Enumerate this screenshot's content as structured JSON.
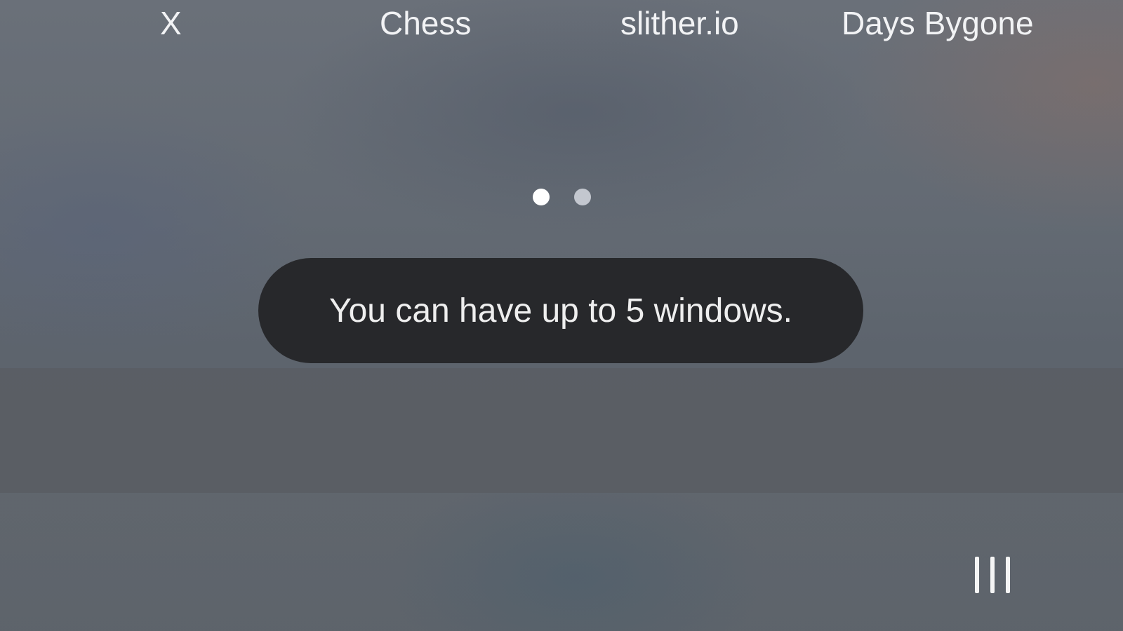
{
  "app_bar": {
    "items": [
      {
        "label": "X"
      },
      {
        "label": "Chess"
      },
      {
        "label": "slither.io"
      },
      {
        "label": "Days Bygone"
      }
    ]
  },
  "page_indicator": {
    "total_pages": 2,
    "current_page": 1
  },
  "toast": {
    "message": "You can have up to 5 windows."
  },
  "navigation_bar": {
    "recents_icon": "recents-icon"
  },
  "colors": {
    "toast_background": "#27282b",
    "label_text": "#f2f3f5",
    "dot_active": "#ffffff",
    "dot_inactive": "#c3c7cf"
  }
}
